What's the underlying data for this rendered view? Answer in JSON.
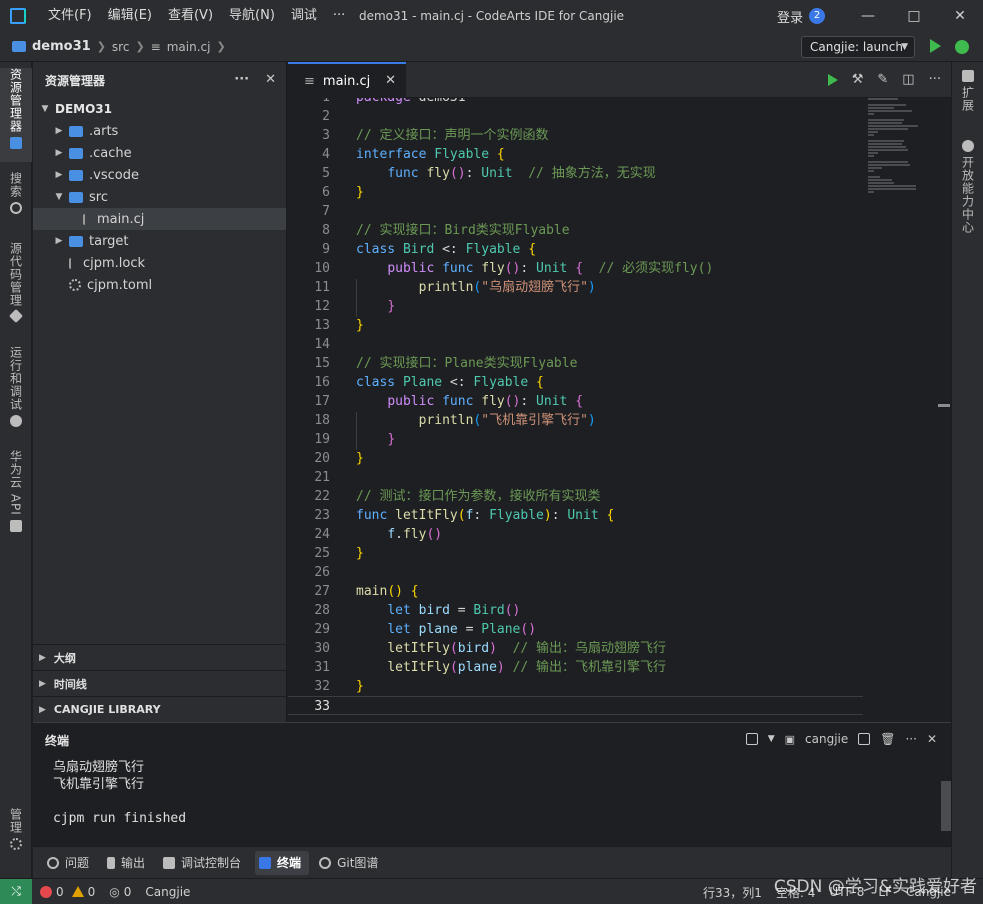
{
  "titlebar": {
    "menu": [
      "文件(F)",
      "编辑(E)",
      "查看(V)",
      "导航(N)",
      "调试",
      "···"
    ],
    "title": "demo31 - main.cj - CodeArts IDE for Cangjie",
    "login": "登录",
    "badge": "2"
  },
  "breadcrumb": {
    "project": "demo31",
    "parts": [
      "src",
      "main.cj"
    ],
    "run_config": "Cangjie: launch"
  },
  "activity_left": {
    "explorer": "资源管理器",
    "search": "搜索",
    "scm": "源代码管理",
    "run_debug": "运行和调试",
    "huawei_api": "华为云 API",
    "manage": "管理"
  },
  "activity_right": {
    "extensions": "扩展",
    "dev_center": "开放能力中心"
  },
  "explorer": {
    "title": "资源管理器",
    "root": "DEMO31",
    "items": [
      {
        "label": ".arts",
        "kind": "folder",
        "expanded": false,
        "indent": 1
      },
      {
        "label": ".cache",
        "kind": "folder",
        "expanded": false,
        "indent": 1
      },
      {
        "label": ".vscode",
        "kind": "folder",
        "expanded": false,
        "indent": 1
      },
      {
        "label": "src",
        "kind": "folder",
        "expanded": true,
        "indent": 1
      },
      {
        "label": "main.cj",
        "kind": "file",
        "indent": 2,
        "selected": true
      },
      {
        "label": "target",
        "kind": "folder",
        "expanded": false,
        "indent": 1
      },
      {
        "label": "cjpm.lock",
        "kind": "file",
        "indent": 1
      },
      {
        "label": "cjpm.toml",
        "kind": "gear",
        "indent": 1
      }
    ],
    "sections": [
      "大纲",
      "时间线",
      "CANGJIE LIBRARY"
    ]
  },
  "editor": {
    "tab": "main.cj",
    "current_line": 33
  },
  "panel": {
    "title": "终端",
    "shell": "cangjie",
    "lines": [
      "乌扇动翅膀飞行",
      "飞机靠引擎飞行",
      "",
      "cjpm run finished"
    ]
  },
  "tooltabs": [
    "问题",
    "输出",
    "调试控制台",
    "终端",
    "Git图谱"
  ],
  "status": {
    "remote": "⤭",
    "errors": "0",
    "warnings": "0",
    "ports": "0",
    "language": "Cangjie",
    "position": "行33，列1",
    "spaces": "空格: 4",
    "encoding": "UTF-8",
    "eol": "LF",
    "mode": "Cangjie"
  },
  "watermark": "CSDN @学习&实践爱好者"
}
